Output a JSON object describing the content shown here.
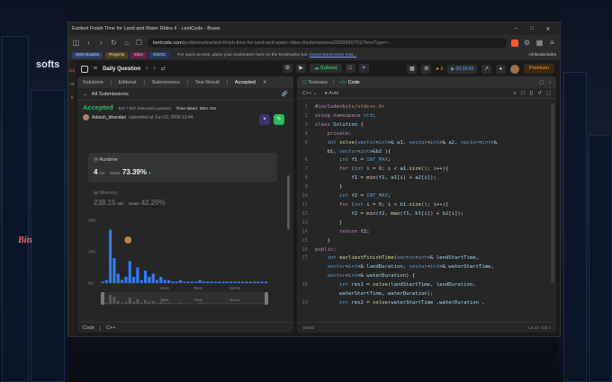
{
  "window": {
    "title": "Earliest Finish Time for Land and Water Rides II - LeetCode - Brave"
  },
  "browser": {
    "url_host": "leetcode.com",
    "url_path": "/problems/earliest-finish-time-for-land-and-water-rides-ii/submissions/2020965701/?envType=...",
    "bookmarks": [
      "Sem Exams",
      "Projects",
      "DSA",
      "GSOC"
    ],
    "bookmark_colors": [
      "#3c5a99",
      "#6b5a2a",
      "#8a2a5a",
      "#2a4a8a"
    ],
    "bookmark_note": "For quick access, place your bookmarks here on the bookmarks bar.",
    "bookmark_import": "Import bookmarks now...",
    "all_bookmarks": "All Bookmarks"
  },
  "rail": [
    "DS",
    "JS",
    "X"
  ],
  "toolbar": {
    "daily_question": "Daily Question",
    "submit": "Submit",
    "streak": "3",
    "timer": "00:39:43",
    "premium": "Premium"
  },
  "left_tabs": [
    "Solutions",
    "Editorial",
    "Submissions",
    "Test Result",
    "Accepted"
  ],
  "submission": {
    "back": "All Submissions",
    "status": "Accepted",
    "passed": "837 / 837 testcases passed",
    "time_taken": "Time taken: 39m 43s",
    "user": "Adarsh_bhandari",
    "submitted": "submitted at Jun 03, 2026 12:44"
  },
  "runtime": {
    "label": "Runtime",
    "value": "4",
    "unit": "ms",
    "beats_label": "Beats",
    "beats": "73.39%"
  },
  "memory": {
    "label": "Memory",
    "value": "238.15",
    "unit": "MB",
    "beats_label": "Beats",
    "beats": "42.20%"
  },
  "chart_data": {
    "type": "bar",
    "y_ticks": [
      "20%",
      "10%",
      "0%"
    ],
    "x_labels": [
      "11ms",
      "75ms",
      "163ms"
    ],
    "mini_labels": [
      "11ms",
      "75ms",
      "163ms"
    ],
    "ylim": [
      0,
      20
    ],
    "values": [
      0.5,
      1,
      17,
      8,
      3,
      1,
      2,
      7,
      2,
      5,
      1,
      4,
      2,
      3,
      1,
      2,
      1,
      1,
      0.5,
      0.5,
      1,
      0.5,
      0.5,
      0.5,
      0.5,
      1,
      0.5,
      0.5,
      0.5,
      0.5,
      0.5,
      0.5,
      0.5,
      0.5,
      0.5,
      0.5,
      0.5,
      0.5,
      0.5,
      0.5,
      0.5,
      0.5,
      0.5
    ],
    "highlight_index": 2,
    "bar_color": "#2f7cf6"
  },
  "left_footer": [
    "Code",
    "C++"
  ],
  "right_tabs": [
    "Testcase",
    "Code"
  ],
  "editor": {
    "language": "C++",
    "mode": "Auto",
    "status_left": "Saved",
    "status_right": "Ln 22, Col 2"
  },
  "code_lines": [
    {
      "n": "1",
      "t": "#include<bits/stdc++.h>"
    },
    {
      "n": "2",
      "t": "using namespace std;"
    },
    {
      "n": "3",
      "t": "class Solution {"
    },
    {
      "n": "4",
      "t": "    private:"
    },
    {
      "n": "5",
      "t": "    int solve(vector<int>& a1, vector<int>& a2, vector<int>&"
    },
    {
      "n": "",
      "t": "    b1, vector<int>&b2 ){"
    },
    {
      "n": "6",
      "t": "        int f1 = INT_MAX;"
    },
    {
      "n": "7",
      "t": "        for (int i = 0; i < a1.size(); i++){"
    },
    {
      "n": "8",
      "t": "            f1 = min(f1, a1[i] + a2[i]);"
    },
    {
      "n": "9",
      "t": "        }"
    },
    {
      "n": "10",
      "t": "        int f2 = INT_MAX;"
    },
    {
      "n": "11",
      "t": "        for (int i = 0; i < b1.size(); i++){"
    },
    {
      "n": "12",
      "t": "            f2 = min(f2, max(f1, b1[i]) + b2[i]);"
    },
    {
      "n": "13",
      "t": "        }"
    },
    {
      "n": "14",
      "t": "        return f2;"
    },
    {
      "n": "15",
      "t": "    }"
    },
    {
      "n": "16",
      "t": "public:"
    },
    {
      "n": "17",
      "t": "    int earliestFinishTime(vector<int>& landStartTime,"
    },
    {
      "n": "",
      "t": "    vector<int>& landDuration, vector<int>& waterStartTime,"
    },
    {
      "n": "",
      "t": "    vector<int>& waterDuration) {"
    },
    {
      "n": "18",
      "t": "        int res1 = solve(landStartTime, landDuration,"
    },
    {
      "n": "",
      "t": "        waterStartTime, waterDuration);"
    },
    {
      "n": "19",
      "t": "        int res2 = solve(waterStartTime ,waterDuration ,"
    }
  ],
  "wallpaper": {
    "sign_left": "softs",
    "sign_right": "Bits"
  }
}
